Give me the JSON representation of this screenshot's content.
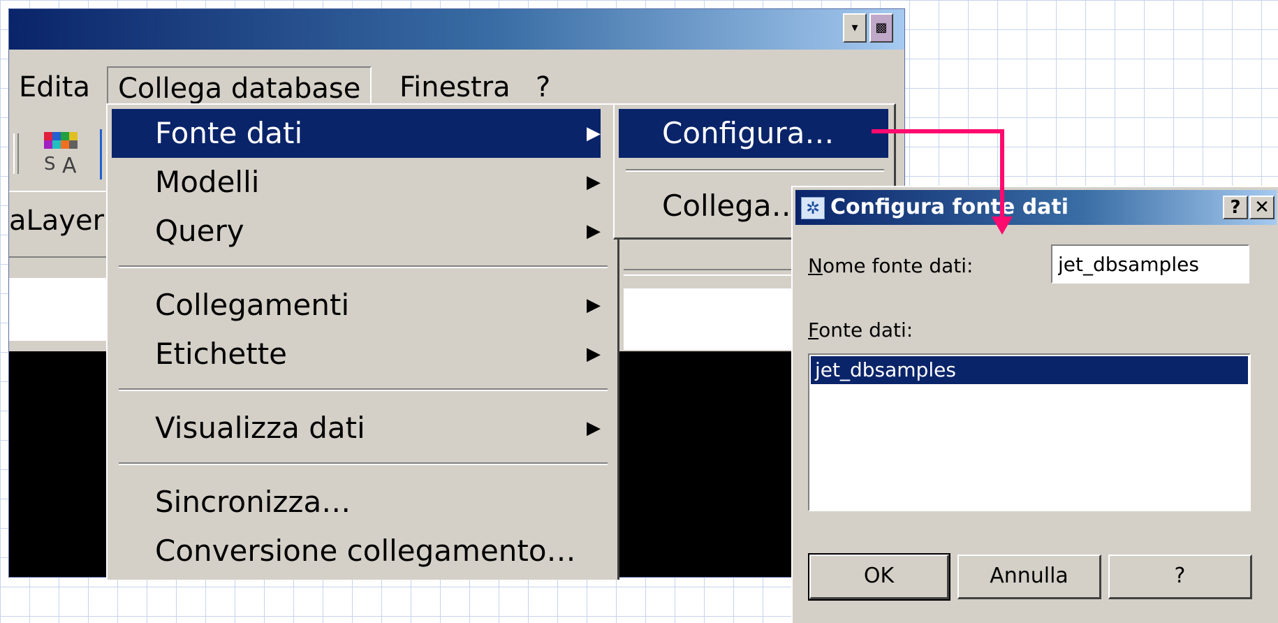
{
  "menubar": {
    "items": [
      "Edita",
      "Collega database",
      "Finestra",
      "?"
    ],
    "active": "Collega database"
  },
  "toolbar": {
    "layer_label": "aLayer"
  },
  "menu_collega_database": {
    "items": [
      {
        "label": "Fonte dati",
        "submenu": true,
        "highlighted": true
      },
      {
        "label": "Modelli",
        "submenu": true
      },
      {
        "label": "Query",
        "submenu": true
      },
      {
        "label": "Collegamenti",
        "submenu": true
      },
      {
        "label": "Etichette",
        "submenu": true
      },
      {
        "label": "Visualizza dati",
        "submenu": true
      },
      {
        "label": "Sincronizza…",
        "submenu": false
      },
      {
        "label": "Conversione collegamento…",
        "submenu": false
      }
    ],
    "submenu_arrow": "▶"
  },
  "submenu_fonte_dati": {
    "items": [
      {
        "label": "Configura…",
        "highlighted": true
      },
      {
        "label": "Collega…"
      }
    ]
  },
  "dialog": {
    "title": "Configura fonte dati",
    "help_button": "?",
    "close_button": "✕",
    "name_label_first": "N",
    "name_label_rest": "ome fonte dati:",
    "name_value": "jet_dbsamples",
    "source_label_first": "F",
    "source_label_rest": "onte dati:",
    "sources": [
      "jet_dbsamples"
    ],
    "selected_source": "jet_dbsamples",
    "buttons": {
      "ok": "OK",
      "cancel": "Annulla",
      "help": "?"
    }
  },
  "colors": {
    "highlight": "#0a246a",
    "arrow": "#ff0a6e",
    "face": "#d4d0c8"
  },
  "icons": [
    "minimize-icon",
    "restore-icon",
    "toolbar-color-icon",
    "submenu-arrow-icon",
    "dialog-icon",
    "connector-arrow-icon"
  ]
}
